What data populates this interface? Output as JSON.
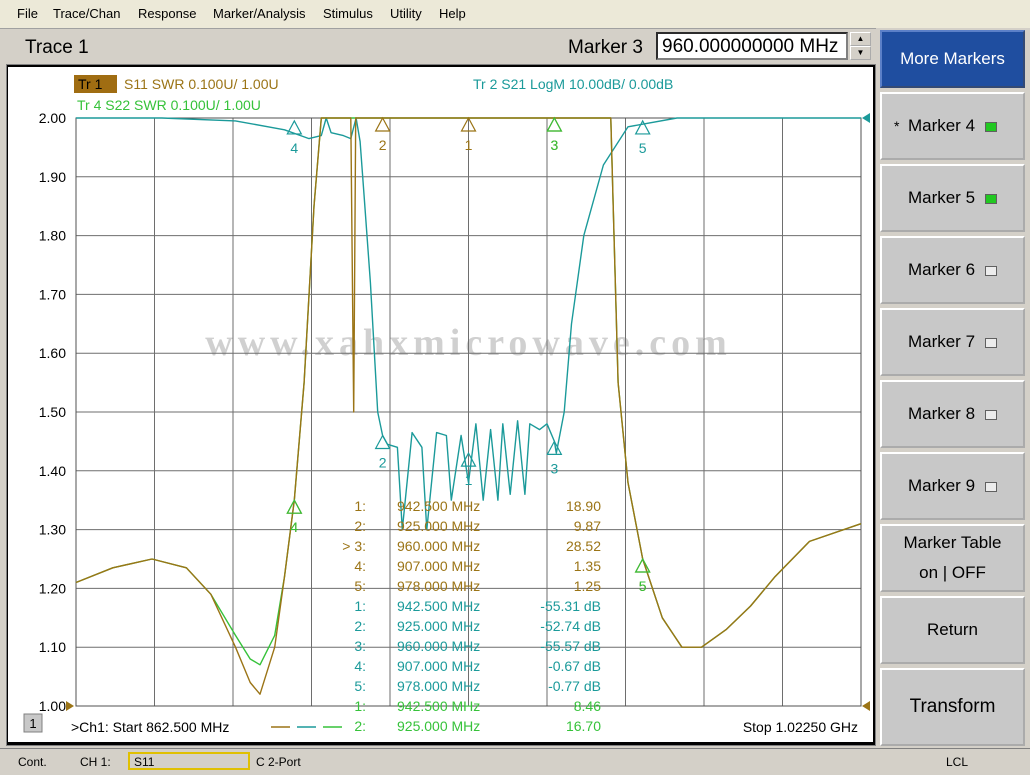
{
  "menu": [
    "File",
    "Trace/Chan",
    "Response",
    "Marker/Analysis",
    "Stimulus",
    "Utility",
    "Help"
  ],
  "toolbar": {
    "trace_title": "Trace 1",
    "marker_label": "Marker 3",
    "marker_value": "960.000000000 MHz"
  },
  "plot": {
    "tr1_badge": "Tr 1",
    "tr1_label": "S11 SWR 0.100U/ 1.00U",
    "tr4_label": "Tr 4  S22 SWR 0.100U/ 1.00U",
    "tr2_label": "Tr 2  S21 LogM 10.00dB/ 0.00dB",
    "watermark": "www.xahxmicrowave.com",
    "channel_badge": "1",
    "start_label": ">Ch1: Start  862.500 MHz",
    "stop_label": "Stop  1.02250 GHz",
    "colors": {
      "s11": "#9b7416",
      "s21": "#1b9a9a",
      "s22": "#36c23a"
    },
    "marker_table": [
      {
        "num": "1:",
        "freq": "942.500 MHz",
        "val": "18.90",
        "color": "#9b7416"
      },
      {
        "num": "2:",
        "freq": "925.000 MHz",
        "val": "9.87",
        "color": "#9b7416"
      },
      {
        "num": "> 3:",
        "freq": "960.000 MHz",
        "val": "28.52",
        "color": "#9b7416"
      },
      {
        "num": "4:",
        "freq": "907.000 MHz",
        "val": "1.35",
        "color": "#9b7416"
      },
      {
        "num": "5:",
        "freq": "978.000 MHz",
        "val": "1.25",
        "color": "#9b7416"
      },
      {
        "num": "1:",
        "freq": "942.500 MHz",
        "val": "-55.31 dB",
        "color": "#1b9a9a"
      },
      {
        "num": "2:",
        "freq": "925.000 MHz",
        "val": "-52.74 dB",
        "color": "#1b9a9a"
      },
      {
        "num": "3:",
        "freq": "960.000 MHz",
        "val": "-55.57 dB",
        "color": "#1b9a9a"
      },
      {
        "num": "4:",
        "freq": "907.000 MHz",
        "val": "-0.67 dB",
        "color": "#1b9a9a"
      },
      {
        "num": "5:",
        "freq": "978.000 MHz",
        "val": "-0.77 dB",
        "color": "#1b9a9a"
      },
      {
        "num": "1:",
        "freq": "942.500 MHz",
        "val": "8.46",
        "color": "#36c23a"
      },
      {
        "num": "2:",
        "freq": "925.000 MHz",
        "val": "16.70",
        "color": "#36c23a"
      }
    ]
  },
  "chart_data": {
    "type": "line",
    "xlim": [
      862.5,
      1022.5
    ],
    "x_unit": "MHz",
    "ylim": [
      1.0,
      2.0
    ],
    "y_ticks": [
      "2.00",
      "1.90",
      "1.80",
      "1.70",
      "1.60",
      "1.50",
      "1.40",
      "1.30",
      "1.20",
      "1.10",
      "1.00"
    ],
    "grid": true,
    "series": [
      {
        "name": "S11 SWR",
        "color": "#9b7416",
        "x": [
          862.5,
          870,
          878,
          885,
          890,
          895,
          898,
          900,
          903,
          905,
          907,
          909,
          911,
          912.5,
          913.5,
          916,
          918.5,
          919.1,
          919.5,
          920,
          922,
          925,
          935,
          950,
          965,
          970,
          971.5,
          972,
          973,
          975,
          978,
          982,
          986,
          990,
          995,
          1000,
          1005,
          1012,
          1022.5
        ],
        "y": [
          1.21,
          1.235,
          1.25,
          1.235,
          1.19,
          1.1,
          1.04,
          1.02,
          1.1,
          1.22,
          1.35,
          1.55,
          1.85,
          2.0,
          2.0,
          2.0,
          2.0,
          1.5,
          2.0,
          2.0,
          2.0,
          2.0,
          2.0,
          2.0,
          2.0,
          2.0,
          2.0,
          1.85,
          1.55,
          1.38,
          1.25,
          1.15,
          1.1,
          1.1,
          1.13,
          1.17,
          1.22,
          1.28,
          1.31
        ]
      },
      {
        "name": "S22 SWR",
        "color": "#36c23a",
        "x": [
          862.5,
          870,
          878,
          885,
          890,
          895,
          898,
          900,
          903,
          905,
          907,
          909,
          911,
          912.5,
          913.5,
          916,
          919,
          922,
          925,
          935,
          950,
          965,
          970,
          971.5,
          972,
          973,
          975,
          978,
          982,
          986,
          990,
          995,
          1000,
          1005,
          1012,
          1022.5
        ],
        "y": [
          1.21,
          1.235,
          1.25,
          1.235,
          1.19,
          1.12,
          1.08,
          1.07,
          1.12,
          1.22,
          1.35,
          1.55,
          1.85,
          2.0,
          2.0,
          2.0,
          2.0,
          2.0,
          2.0,
          2.0,
          2.0,
          2.0,
          2.0,
          2.0,
          1.85,
          1.55,
          1.38,
          1.25,
          1.15,
          1.1,
          1.1,
          1.13,
          1.17,
          1.22,
          1.28,
          1.31
        ]
      },
      {
        "name": "S21 LogM",
        "color": "#1b9a9a",
        "x": [
          862.5,
          880,
          895,
          905,
          910,
          912.5,
          913.5,
          914.5,
          917,
          918.5,
          919.6,
          920.4,
          921.2,
          922.5,
          924,
          925,
          926,
          928,
          929,
          931,
          933,
          934,
          936,
          938,
          939,
          941,
          942.5,
          944,
          945.5,
          947,
          948.5,
          949.5,
          951,
          952.5,
          954,
          955,
          957,
          958.5,
          960,
          960.4,
          962,
          963.5,
          966,
          970,
          975,
          985,
          1000,
          1022.5
        ],
        "y": [
          2.0,
          2.0,
          1.995,
          1.98,
          1.965,
          1.97,
          2.0,
          1.975,
          1.97,
          1.965,
          2.0,
          1.96,
          1.87,
          1.72,
          1.5,
          1.46,
          1.445,
          1.44,
          1.3,
          1.465,
          1.44,
          1.3,
          1.465,
          1.46,
          1.35,
          1.46,
          1.38,
          1.48,
          1.35,
          1.47,
          1.35,
          1.48,
          1.36,
          1.485,
          1.36,
          1.48,
          1.47,
          1.48,
          1.45,
          1.43,
          1.5,
          1.65,
          1.8,
          1.92,
          1.985,
          2.0,
          2.0,
          2.0
        ]
      }
    ],
    "markers": [
      {
        "label": "1",
        "x": 942.5,
        "y": 2.0,
        "color": "#9b7416"
      },
      {
        "label": "2",
        "x": 925.0,
        "y": 2.0,
        "color": "#9b7416"
      },
      {
        "label": "3",
        "x": 960.0,
        "y": 2.0,
        "color": "#9b7416"
      },
      {
        "label": "4",
        "x": 907.0,
        "y": 1.35,
        "color": "#9b7416"
      },
      {
        "label": "5",
        "x": 978.0,
        "y": 1.25,
        "color": "#9b7416"
      },
      {
        "label": "1",
        "x": 942.5,
        "y": 1.43,
        "color": "#1b9a9a"
      },
      {
        "label": "2",
        "x": 925.0,
        "y": 1.46,
        "color": "#1b9a9a"
      },
      {
        "label": "3",
        "x": 960.0,
        "y": 1.45,
        "color": "#1b9a9a"
      },
      {
        "label": "4",
        "x": 907.0,
        "y": 1.995,
        "color": "#1b9a9a"
      },
      {
        "label": "5",
        "x": 978.0,
        "y": 1.995,
        "color": "#1b9a9a"
      },
      {
        "label": "3",
        "x": 960.0,
        "y": 2.0,
        "color": "#36c23a"
      },
      {
        "label": "4",
        "x": 907.0,
        "y": 1.35,
        "color": "#36c23a"
      },
      {
        "label": "5",
        "x": 978.0,
        "y": 1.25,
        "color": "#36c23a"
      }
    ]
  },
  "softkeys": {
    "more_markers": "More Markers",
    "markers": [
      {
        "label": "Marker 4",
        "star": "*",
        "on": true
      },
      {
        "label": "Marker 5",
        "star": "",
        "on": true
      },
      {
        "label": "Marker 6",
        "star": "",
        "on": false
      },
      {
        "label": "Marker 7",
        "star": "",
        "on": false
      },
      {
        "label": "Marker 8",
        "star": "",
        "on": false
      },
      {
        "label": "Marker 9",
        "star": "",
        "on": false
      }
    ],
    "marker_table_line1": "Marker Table",
    "marker_table_line2": "on | OFF",
    "return": "Return",
    "transform": "Transform"
  },
  "status": {
    "cont": "Cont.",
    "ch": "CH 1:",
    "param": "S11",
    "port": "C  2-Port",
    "lcl": "LCL"
  }
}
